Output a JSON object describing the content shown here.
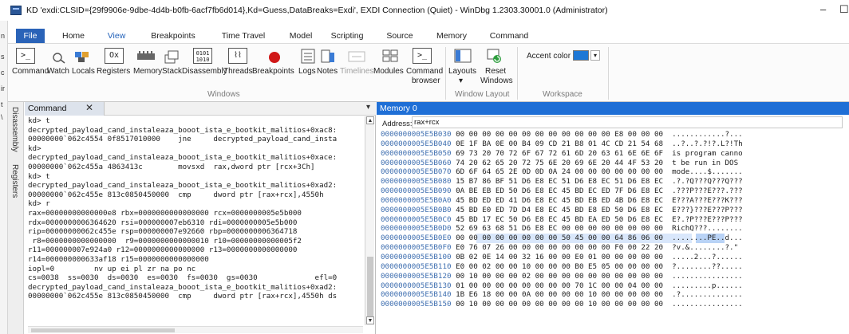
{
  "window": {
    "title": "KD 'exdi:CLSID={29f9906e-9dbe-4d4b-b0fb-6acf7fb6d014},Kd=Guess,DataBreaks=Exdi', EXDI Connection (Quiet) - WinDbg 1.2303.30001.0 (Administrator)",
    "minimize": "–",
    "maximize": "☐"
  },
  "left_sliver": [
    "n",
    "s",
    "c",
    "ir",
    "t",
    "\\"
  ],
  "ribbon_tabs": [
    "File",
    "Home",
    "View",
    "Breakpoints",
    "Time Travel",
    "Model",
    "Scripting",
    "Source",
    "Memory",
    "Command"
  ],
  "ribbon_active_tab": "View",
  "ribbon": {
    "buttons": [
      {
        "label": "Command",
        "icon": "command-icon"
      },
      {
        "label": "Watch",
        "icon": "watch-icon"
      },
      {
        "label": "Locals",
        "icon": "locals-icon"
      },
      {
        "label": "Registers",
        "icon": "registers-icon"
      },
      {
        "label": "Memory",
        "icon": "memory-icon"
      },
      {
        "label": "Stack",
        "icon": "stack-icon"
      },
      {
        "label": "Disassembly",
        "icon": "disassembly-icon"
      },
      {
        "label": "Threads",
        "icon": "threads-icon"
      },
      {
        "label": "Breakpoints",
        "icon": "breakpoints-icon"
      },
      {
        "label": "Logs",
        "icon": "logs-icon"
      },
      {
        "label": "Notes",
        "icon": "notes-icon"
      },
      {
        "label": "Timelines",
        "icon": "timelines-icon"
      },
      {
        "label": "Modules",
        "icon": "modules-icon"
      },
      {
        "label": "Command",
        "icon": "command-browser-icon"
      },
      {
        "label": "Layouts",
        "icon": "layouts-icon"
      },
      {
        "label": "Reset",
        "icon": "reset-icon"
      }
    ],
    "command_browser_second": "browser",
    "layouts_second": "▾",
    "reset_second": "Windows",
    "accent_label": "Accent color",
    "accent_color": "#1e78d6",
    "groups": [
      "Windows",
      "Window Layout",
      "Workspace"
    ]
  },
  "side_tabs": [
    "Disassembly",
    "Registers"
  ],
  "command_pane": {
    "tab_label": "Command",
    "close": "✕",
    "pin": "▾",
    "lines": [
      "kd> t",
      "decrypted_payload_cand_instaleaza_booot_ista_e_bootkit_malitios+0xac8:",
      "00000000`062c4554 0f8517010000    jne     decrypted_payload_cand_insta",
      "kd>",
      "decrypted_payload_cand_instaleaza_booot_ista_e_bootkit_malitios+0xace:",
      "00000000`062c455a 4863413c        movsxd  rax,dword ptr [rcx+3Ch]",
      "kd> t",
      "decrypted_payload_cand_instaleaza_booot_ista_e_bootkit_malitios+0xad2:",
      "00000000`062c455e 813c0850450000  cmp     dword ptr [rax+rcx],4550h",
      "kd> r",
      "rax=00000000000000e8 rbx=0000000000000000 rcx=0000000005e5b000",
      "rdx=0000000006364620 rsi=000000007eb6310 rdi=0000000005e5b000",
      "rip=00000000062c455e rsp=000000007e92660 rbp=0000000006364718",
      " r8=0000000000000000  r9=0000000000000010 r10=00000000000005f2",
      "r11=000000007e924a0 r12=0000000000000000 r13=0000000000000000",
      "r14=000000000633af18 r15=0000000000000000",
      "iopl=0         nv up ei pl zr na po nc",
      "cs=0038  ss=0030  ds=0030  es=0030  fs=0030  gs=0030             efl=0",
      "decrypted_payload_cand_instaleaza_booot_ista_e_bootkit_malitios+0xad2:",
      "00000000`062c455e 813c0850450000  cmp     dword ptr [rax+rcx],4550h ds"
    ]
  },
  "memory_pane": {
    "title": "Memory 0",
    "address_label": "Address:",
    "address_value": "rax+rcx",
    "rows": [
      {
        "addr": "0000000005E5B030",
        "hex": "00 00 00 00 00 00 00 00 00 00 00 00 E8 00 00 00",
        "ascii": "............?..."
      },
      {
        "addr": "0000000005E5B040",
        "hex": "0E 1F BA 0E 00 B4 09 CD 21 B8 01 4C CD 21 54 68",
        "ascii": "..?..?.?!?.L?!Th"
      },
      {
        "addr": "0000000005E5B050",
        "hex": "69 73 20 70 72 6F 67 72 61 6D 20 63 61 6E 6E 6F",
        "ascii": "is program canno"
      },
      {
        "addr": "0000000005E5B060",
        "hex": "74 20 62 65 20 72 75 6E 20 69 6E 20 44 4F 53 20",
        "ascii": "t be run in DOS "
      },
      {
        "addr": "0000000005E5B070",
        "hex": "6D 6F 64 65 2E 0D 0D 0A 24 00 00 00 00 00 00 00",
        "ascii": "mode....$......."
      },
      {
        "addr": "0000000005E5B080",
        "hex": "15 B7 86 BF 51 D6 E8 EC 51 D6 E8 EC 51 D6 E8 EC",
        "ascii": ".?.?Q???Q???Q???"
      },
      {
        "addr": "0000000005E5B090",
        "hex": "0A BE EB ED 50 D6 E8 EC 45 BD EC ED 7F D6 E8 EC",
        "ascii": ".???P???E???.???"
      },
      {
        "addr": "0000000005E5B0A0",
        "hex": "45 BD ED ED 41 D6 E8 EC 45 BD EB ED 4B D6 E8 EC",
        "ascii": "E???A???E???K???"
      },
      {
        "addr": "0000000005E5B0B0",
        "hex": "45 BD E0 ED 7D D4 E8 EC 45 BD E8 ED 50 D6 E8 EC",
        "ascii": "E???}???E???P???"
      },
      {
        "addr": "0000000005E5B0C0",
        "hex": "45 BD 17 EC 50 D6 E8 EC 45 BD EA ED 50 D6 E8 EC",
        "ascii": "E?.?P???E???P???"
      },
      {
        "addr": "0000000005E5B0D0",
        "hex": "52 69 63 68 51 D6 E8 EC 00 00 00 00 00 00 00 00",
        "ascii": "RichQ???........"
      },
      {
        "addr": "0000000005E5B0E0",
        "hex": "00 00 00 00 00 00 00 00 50 45 00 00 64 86 06 00",
        "ascii": "........PE..d..."
      },
      {
        "addr": "0000000005E5B0F0",
        "hex": "E0 76 07 26 00 00 00 00 00 00 00 00 F0 00 22 20",
        "ascii": "?v.&........?.\" "
      },
      {
        "addr": "0000000005E5B100",
        "hex": "0B 02 0E 14 00 32 16 00 00 E0 01 00 00 00 00 00",
        "ascii": ".....2...?......"
      },
      {
        "addr": "0000000005E5B110",
        "hex": "E0 00 02 00 00 10 00 00 00 B0 E5 05 00 00 00 00",
        "ascii": "?........??....."
      },
      {
        "addr": "0000000005E5B120",
        "hex": "00 10 00 00 00 02 00 00 00 00 00 00 00 00 00 00",
        "ascii": "................"
      },
      {
        "addr": "0000000005E5B130",
        "hex": "01 00 00 00 00 00 00 00 00 70 1C 00 00 04 00 00",
        "ascii": ".........p......"
      },
      {
        "addr": "0000000005E5B140",
        "hex": "1B E6 18 00 00 0A 00 00 00 00 10 00 00 00 00 00",
        "ascii": ".?.............."
      },
      {
        "addr": "0000000005E5B150",
        "hex": "00 10 00 00 00 00 00 00 00 00 10 00 00 00 00 00",
        "ascii": "................"
      }
    ],
    "highlight_row": 11
  }
}
